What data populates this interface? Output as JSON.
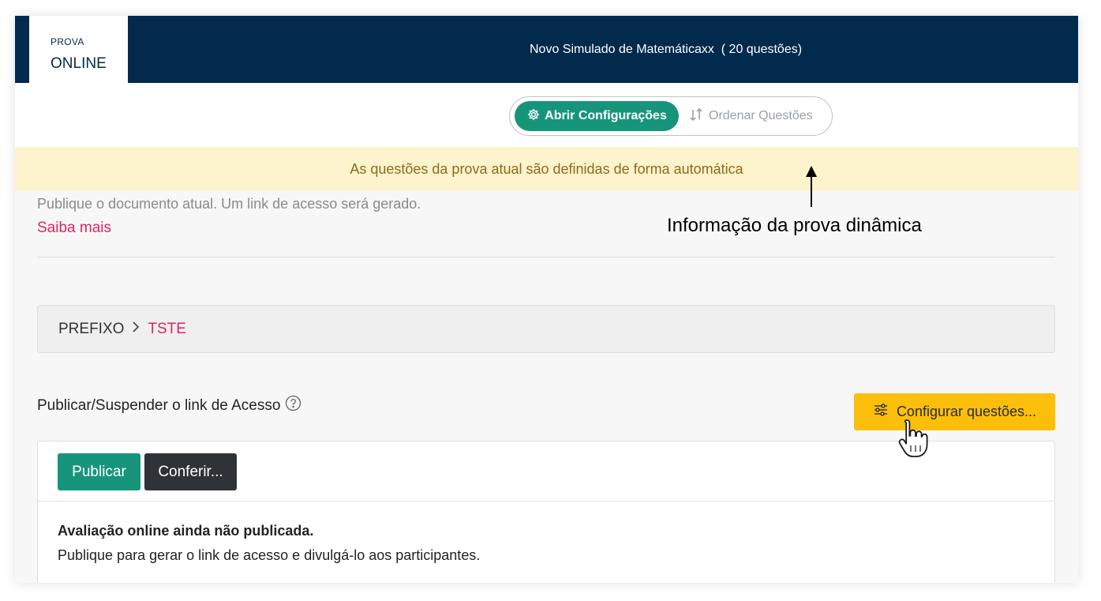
{
  "brand": {
    "small": "PROVA",
    "big": "ONLINE"
  },
  "header": {
    "title": "Novo Simulado de Matemáticaxx  ( 20 questões)"
  },
  "toolbar": {
    "config_label": "Abrir Configurações",
    "config_icon": "gear-icon",
    "order_label": "Ordenar Questões",
    "order_icon": "sort-arrows-icon"
  },
  "alert": {
    "text": "As questões da prova atual são definidas de forma automática"
  },
  "annotation": {
    "text": "Informação da prova dinâmica"
  },
  "publish": {
    "hint": "Publique o documento atual. Um link de acesso será gerado.",
    "learn_more": "Saiba mais"
  },
  "breadcrumb": {
    "prefix": "PREFIXO",
    "separator": "›",
    "current": "TSTE"
  },
  "access": {
    "title": "Publicar/Suspender o link de Acesso",
    "help_icon": "question-circle-icon",
    "configure_label": "Configurar questões...",
    "configure_icon": "sliders-icon"
  },
  "card": {
    "publish_label": "Publicar",
    "check_label": "Conferir...",
    "status_title": "Avaliação online ainda não publicada.",
    "status_text": "Publique para gerar o link de acesso e divulgá-lo aos participantes."
  },
  "colors": {
    "header_bg": "#022a4c",
    "primary_green": "#17957b",
    "alert_bg": "#fdf3cd",
    "alert_text": "#8a6d1b",
    "accent_pink": "#e0245e",
    "warning_yellow": "#fbbf0b",
    "dark_button": "#2f3337"
  }
}
